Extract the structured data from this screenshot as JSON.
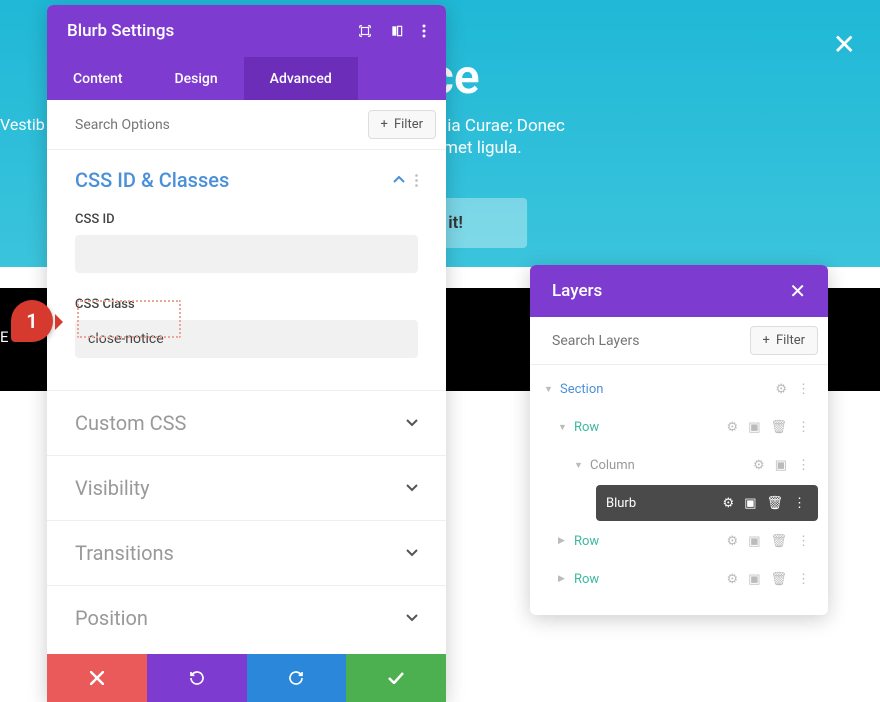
{
  "bg": {
    "title_fragment": "tice",
    "line1": "ces posuere cubilia Curae; Donec",
    "line2": "corper sit amet ligula.",
    "side": "Vestib",
    "button": "Got it!",
    "darkbar": "E"
  },
  "panel": {
    "title": "Blurb Settings",
    "tabs": {
      "content": "Content",
      "design": "Design",
      "advanced": "Advanced"
    },
    "search_placeholder": "Search Options",
    "filter_label": "Filter",
    "section1": {
      "title": "CSS ID & Classes",
      "css_id_label": "CSS ID",
      "css_id_value": "",
      "css_class_label": "CSS Class",
      "css_class_value": "close-notice"
    },
    "collapsed": {
      "custom_css": "Custom CSS",
      "visibility": "Visibility",
      "transitions": "Transitions",
      "position": "Position"
    }
  },
  "callout": {
    "num": "1"
  },
  "layers": {
    "title": "Layers",
    "search_placeholder": "Search Layers",
    "filter_label": "Filter",
    "items": {
      "section": "Section",
      "row1": "Row",
      "column": "Column",
      "blurb": "Blurb",
      "row2": "Row",
      "row3": "Row"
    }
  }
}
